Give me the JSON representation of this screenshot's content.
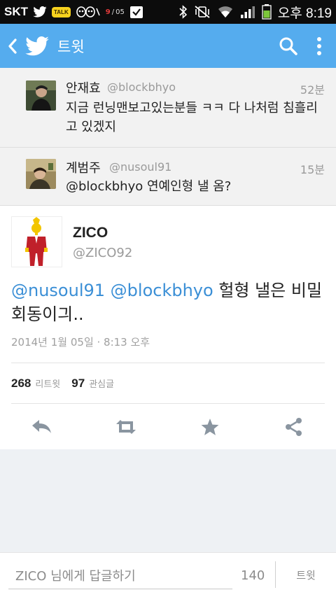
{
  "status_bar": {
    "carrier": "SKT",
    "notif_date": "05",
    "time": "오후 8:19"
  },
  "header": {
    "title": "트윗"
  },
  "replies": [
    {
      "name": "안재효",
      "handle": "@blockbhyo",
      "time": "52분",
      "text": "지금 런닝맨보고있는분들 ㅋㅋ 다 나처럼 침흘리고 있겠지"
    },
    {
      "name": "계범주",
      "handle": "@nusoul91",
      "time": "15분",
      "text": "@blockbhyo 연예인형 낼 옴?"
    }
  ],
  "tweet": {
    "name": "ZICO",
    "handle": "@ZICO92",
    "mention1": "@nusoul91",
    "mention2": "@blockbhyo",
    "text_rest": " 헐형 낼은 비밀회동이긔..",
    "timestamp": "2014년 1월 05일 · 8:13 오후",
    "retweets": "268",
    "retweets_label": "리트윗",
    "favorites": "97",
    "favorites_label": "관심글"
  },
  "composer": {
    "placeholder": "ZICO 님에게 답글하기",
    "count": "140",
    "send_label": "트윗"
  },
  "colors": {
    "accent": "#55acee",
    "mention": "#3b8fd6",
    "muted": "#9a9a9a"
  },
  "icons": {
    "back": "chevron-left-icon",
    "logo": "twitter-bird-icon",
    "search": "search-icon",
    "more": "more-vert-icon",
    "reply": "reply-icon",
    "retweet": "retweet-icon",
    "favorite": "star-icon",
    "share": "share-icon"
  }
}
